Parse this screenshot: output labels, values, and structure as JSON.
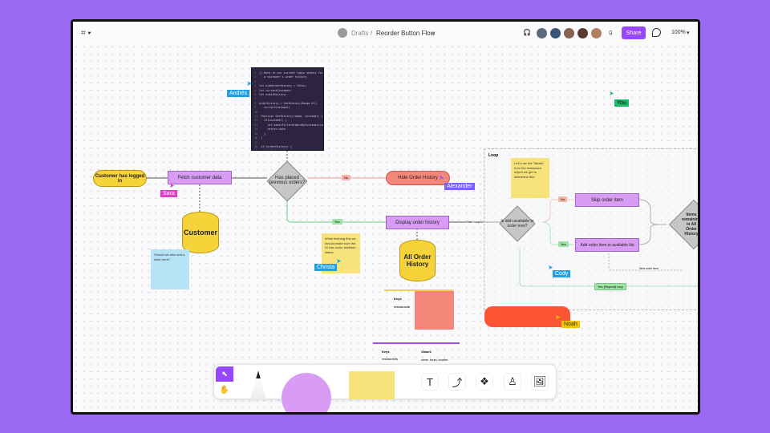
{
  "topbar": {
    "logo": "figjam-logo-icon",
    "breadcrumb_root": "Drafts",
    "separator": "/",
    "file_name": "Reorder Button Flow",
    "collaborator_count": "9",
    "share_label": "Share",
    "zoom": "100%"
  },
  "colors": {
    "accent": "#9747ff",
    "background": "#9a68f2",
    "process": "#d89cf5",
    "terminal_yellow": "#f7d33a",
    "terminal_red": "#f5877a",
    "decision": "#c7c7c7",
    "noah_shape": "#fc5535"
  },
  "flow": {
    "start": "Customer has logged in",
    "fetch": "Fetch customer data",
    "customer_db": "Customer",
    "decision1": "Has placed previous orders?",
    "no1": "No",
    "yes1": "Yes",
    "hide": "Hide Order History",
    "display": "Display order history",
    "start_loop": "Start loop",
    "history_db": "All Order History",
    "section": "Loop",
    "decision2": "Is dish available to order now?",
    "no2": "No",
    "yes2": "Yes",
    "skip": "Skip order item",
    "add": "Add order item to available list",
    "next_item": "Next order item",
    "repeat": "Yes (Repeat) loop",
    "decision3": "Items remaining in All Order History"
  },
  "stickies": {
    "blue": "Should we also add a table here?",
    "yellow1": "While fetching this we should make sure the UI has some skeleton states.",
    "yellow2": "Let's use the \"Meals\" from the restaurant object we get to determine this."
  },
  "code": [
    "// Here is our current logic sheets for",
    "   a customer's order history.",
    "",
    "let hideOrderHistory = false;",
    "let currentCustomer;",
    "let orderHistory;",
    "",
    "orderHistory = GetHistory(Range.All,",
    "   currentCustomer)",
    "",
    "function GetHistory(range, customer) {",
    "  if(customer) {",
    "    let data=FilterOrdersByCustomer(range)",
    "    return data",
    "  }",
    "}",
    "",
    "if(!orderHistory) {",
    "  hideOrderHistory = true",
    "}"
  ],
  "table": {
    "keys_header": "Keys",
    "values_header": "Values",
    "row_key": "restaurants",
    "row_value": "name, hours, location"
  },
  "cursors": {
    "andres": "Andrés",
    "sara": "Sara",
    "alexander": "Alexander",
    "christa": "Christa",
    "cody": "Cody",
    "noah": "Noah",
    "you": "You"
  },
  "toolbar": {
    "move": "cursor-icon",
    "hand": "hand-icon",
    "text": "T",
    "tools": [
      "text-icon",
      "connector-icon",
      "components-icon",
      "stamp-icon",
      "image-icon"
    ]
  }
}
